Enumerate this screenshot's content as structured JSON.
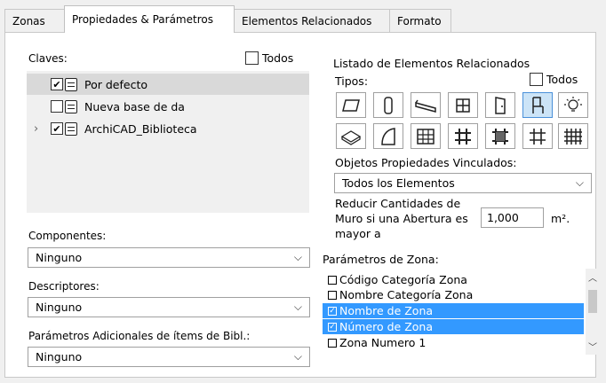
{
  "tabs": [
    {
      "label": "Zonas"
    },
    {
      "label": "Propiedades & Parámetros"
    },
    {
      "label": "Elementos Relacionados"
    },
    {
      "label": "Formato"
    }
  ],
  "claves": {
    "label": "Claves:",
    "todos_label": "Todos",
    "items": [
      {
        "label": "Por defecto",
        "checked": "✔"
      },
      {
        "label": "Nueva base de da",
        "checked": ""
      },
      {
        "label": "ArchiCAD_Biblioteca",
        "checked": "✔"
      }
    ]
  },
  "componentes": {
    "label": "Componentes:",
    "value": "Ninguno"
  },
  "descriptores": {
    "label": "Descriptores:",
    "value": "Ninguno"
  },
  "parametros_adicionales": {
    "label": "Parámetros Adicionales de ítems de Bibl.:",
    "value": "Ninguno"
  },
  "listado": {
    "title": "Listado de Elementos Relacionados",
    "tipos_label": "Tipos:",
    "todos_label": "Todos",
    "type_icons_row1": [
      "slab-icon",
      "column-icon",
      "beam-icon",
      "window-icon",
      "door-icon",
      "chair-object-icon",
      "lamp-icon"
    ],
    "type_icons_row2": [
      "roof-icon",
      "shell-icon",
      "curtain-wall-icon",
      "grid-icon",
      "grid-skewed-icon",
      "grid-dense-icon",
      "grid-hatched-icon"
    ],
    "selected_icon": "chair-object-icon",
    "objetos_label": "Objetos Propiedades Vinculados:",
    "objetos_value": "Todos los Elementos",
    "reducir_line1": "Reducir Cantidades de",
    "reducir_line2": "Muro si una Abertura es",
    "reducir_line3": "mayor a",
    "reducir_value": "1,000",
    "reducir_unit": "m²."
  },
  "parametros_zona": {
    "label": "Parámetros de Zona:",
    "items": [
      {
        "label": "Código Categoría Zona",
        "checked": "",
        "selected": false
      },
      {
        "label": "Nombre Categoría Zona",
        "checked": "",
        "selected": false
      },
      {
        "label": "Nombre de Zona",
        "checked": "✓",
        "selected": true
      },
      {
        "label": "Número de Zona",
        "checked": "✓",
        "selected": true
      },
      {
        "label": "Zona Numero 1",
        "checked": "",
        "selected": false
      }
    ]
  },
  "colors": {
    "selection": "#3399ff",
    "tree_selection": "#d9d9d9",
    "active_icon": "#cce4f7"
  }
}
